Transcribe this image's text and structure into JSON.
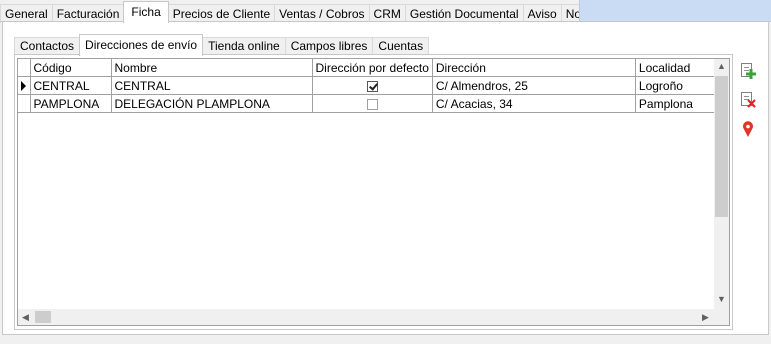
{
  "top_tabs": [
    "General",
    "Facturación",
    "Ficha",
    "Precios de Cliente",
    "Ventas / Cobros",
    "CRM",
    "Gestión Documental",
    "Aviso",
    "Notas"
  ],
  "top_active": "Ficha",
  "inner_tabs": [
    "Contactos",
    "Direcciones de envío",
    "Tienda online",
    "Campos libres",
    "Cuentas"
  ],
  "inner_active": "Direcciones de envío",
  "grid": {
    "columns": {
      "codigo": "Código",
      "nombre": "Nombre",
      "defecto": "Dirección por defecto",
      "direccion": "Dirección",
      "localidad": "Localidad"
    },
    "rows": [
      {
        "codigo": "CENTRAL",
        "nombre": "CENTRAL",
        "defecto": true,
        "direccion": "C/ Almendros, 25",
        "localidad": "Logroño",
        "current": true
      },
      {
        "codigo": "PAMPLONA",
        "nombre": "DELEGACIÓN PLAMPLONA",
        "defecto": false,
        "direccion": "C/ Acacias, 34",
        "localidad": "Pamplona",
        "current": false
      }
    ]
  },
  "toolbar": {
    "icons": [
      "add-document-icon",
      "delete-document-icon",
      "map-pin-icon"
    ],
    "colors": {
      "add": "#3aa335",
      "delete": "#d9262b",
      "pin": "#e0352b"
    }
  },
  "colors": {
    "tab_fill": "#c9dcf4",
    "border": "#a0a0a0"
  }
}
